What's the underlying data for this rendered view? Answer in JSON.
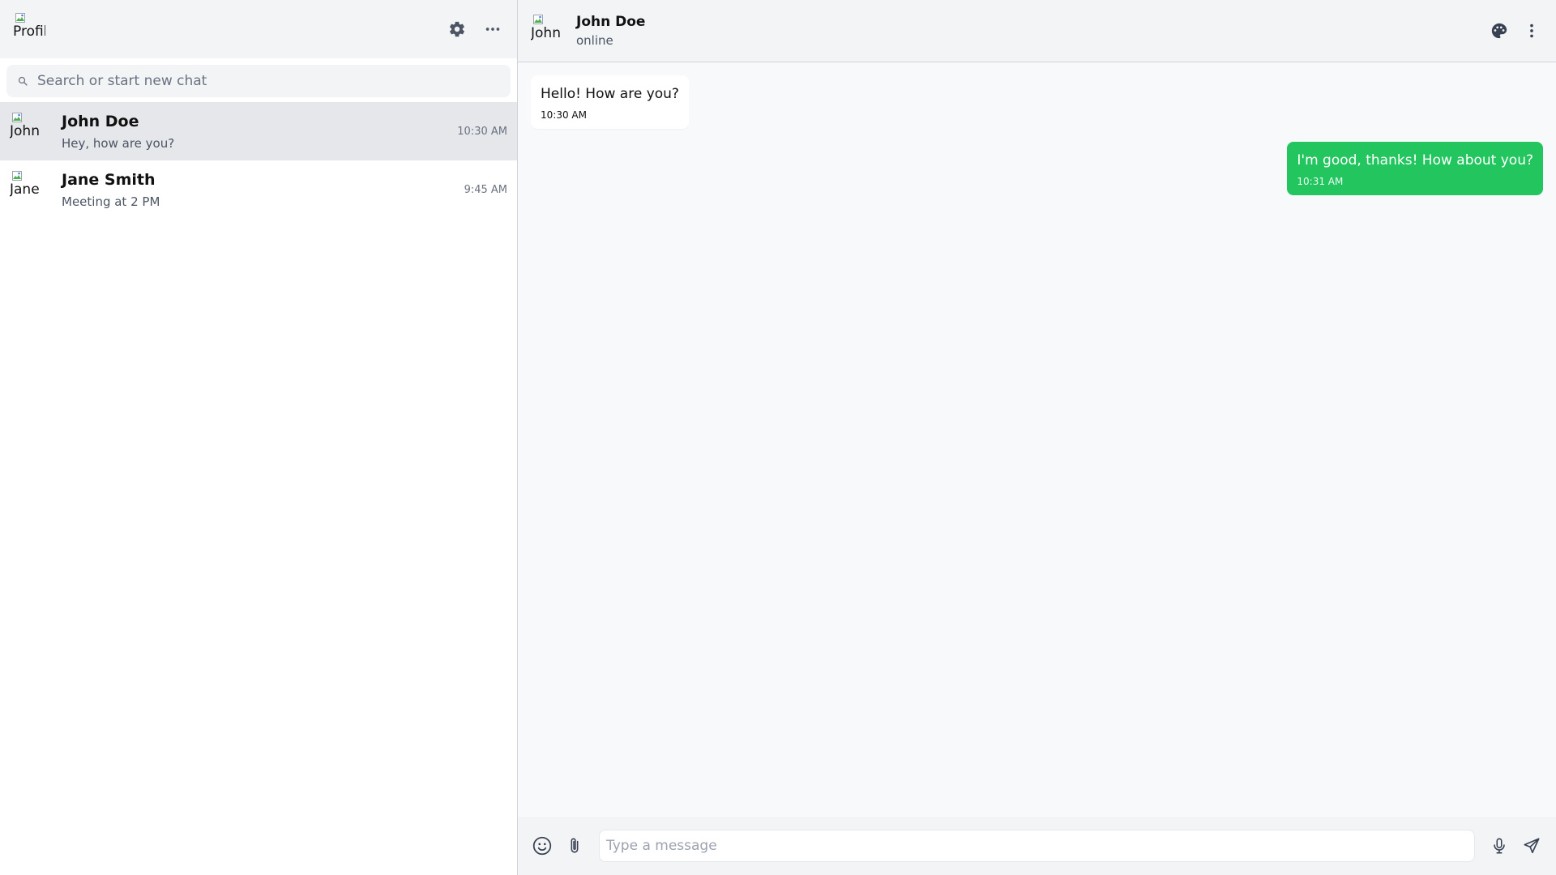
{
  "colors": {
    "accent": "#22c55e",
    "sidebar_active": "#e5e7eb",
    "header_bg": "#f3f4f6",
    "chat_bg": "#f8f9fa"
  },
  "sidebar": {
    "profile_avatar_alt": "Profile",
    "header_icons": [
      "gear-icon",
      "more-horizontal-icon"
    ],
    "search": {
      "placeholder": "Search or start new chat",
      "value": "",
      "icon": "search-icon"
    },
    "chats": [
      {
        "avatar_alt": "John Doe",
        "name": "John Doe",
        "preview": "Hey, how are you?",
        "time": "10:30 AM",
        "active": true
      },
      {
        "avatar_alt": "Jane Smith",
        "name": "Jane Smith",
        "preview": "Meeting at 2 PM",
        "time": "9:45 AM",
        "active": false
      }
    ]
  },
  "chat": {
    "header": {
      "avatar_alt": "John Doe",
      "name": "John Doe",
      "status": "online",
      "icons": [
        "palette-icon",
        "more-vertical-icon"
      ]
    },
    "messages": [
      {
        "direction": "in",
        "text": "Hello! How are you?",
        "time": "10:30 AM"
      },
      {
        "direction": "out",
        "text": "I'm good, thanks! How about you?",
        "time": "10:31 AM"
      }
    ],
    "composer": {
      "placeholder": "Type a message",
      "value": "",
      "icons": [
        "emoji-icon",
        "paperclip-icon",
        "microphone-icon",
        "send-icon"
      ]
    }
  }
}
